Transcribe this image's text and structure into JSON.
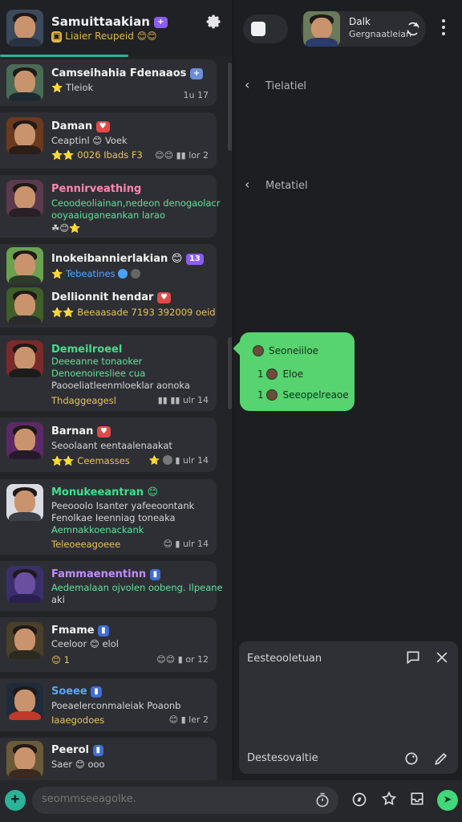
{
  "colors": {
    "accent": "#2bb39a",
    "bubble": "#57d36f",
    "send": "#41d77a"
  },
  "me": {
    "name": "Samuittaakian",
    "status": "Liaier Reupeid"
  },
  "chats": [
    {
      "name": "Camseihahia Fdenaaos",
      "preview": "Tleiok",
      "time": "1u 17",
      "color": ""
    },
    {
      "name": "Daman",
      "preview": "Ceaptinl 😊 Voek",
      "meta_line": "0026 Ibads F3",
      "time": "lor 2",
      "color": ""
    },
    {
      "name": "Pennirveathing",
      "preview": "Ceoodeoliainan,nedeon denogaolacr",
      "preview2": "ooyaaiuganeankan larao",
      "color": "pink"
    },
    {
      "name": "Inokeibannierlakian",
      "preview": "Tebeatines",
      "color": ""
    },
    {
      "name": "Dellionnit hendar",
      "preview": "Beeaasade 7193 392009 oeid",
      "color": ""
    },
    {
      "name": "Demeilroeel",
      "preview": "Deeeanne tonaoker",
      "preview2": "Denoenoiresliee cua",
      "preview3": "Paooeliatleenmloeklar aonoka",
      "meta_line": "Thdaggeagesl",
      "time": "ulr 14",
      "color": "green"
    },
    {
      "name": "Barnan",
      "preview": "Seoolaant eentaalenaakat",
      "meta_line": "Ceemasses",
      "time": "ulr 14",
      "color": ""
    },
    {
      "name": "Monukeeantran",
      "preview": "Peeooolo Isanter yafeeoontank",
      "preview2": "Fenolkae Ieenniag toneaka",
      "preview3": "Aemnakkoenackank",
      "meta_line": "Teleoeeagoeee",
      "time": "ulr 14",
      "color": "green"
    },
    {
      "name": "Fammaenentinn",
      "preview": "Aedemalaan ojvolen oobeng. Ilpeane",
      "preview2": "aki",
      "color": "purple"
    },
    {
      "name": "Fmame",
      "preview": "Ceeloor 😊 elol",
      "time": "or 12",
      "color": ""
    },
    {
      "name": "Soeee",
      "preview": "Poeaelerconmaleiak Poaonb",
      "meta_line": "Iaaegodoes",
      "time": "ler 2",
      "color": "blue"
    },
    {
      "name": "Peerol",
      "preview": "Saer 😊 ooo",
      "color": ""
    }
  ],
  "contact": {
    "name": "Dalk",
    "subtitle": "Gergnaatleian"
  },
  "threads": [
    "Tielatiel",
    "Metatiel"
  ],
  "bubble": {
    "title": "Seoneiiloe",
    "rows": [
      {
        "num": "1",
        "text": "Eloe"
      },
      {
        "num": "1",
        "text": "Seeopelreaoe"
      }
    ]
  },
  "compose": {
    "title": "Eesteooletuan",
    "footer": "Destesovaltie"
  },
  "bottom": {
    "placeholder": "seommseeagolke."
  }
}
